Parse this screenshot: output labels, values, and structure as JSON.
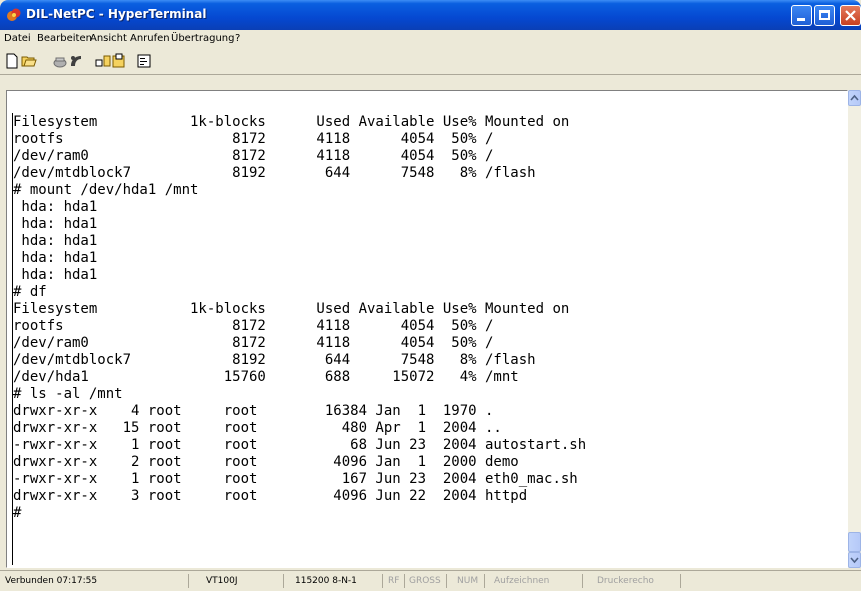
{
  "window": {
    "title": "DIL-NetPC - HyperTerminal"
  },
  "menu": [
    "Datei",
    "Bearbeiten",
    "Ansicht",
    "Anrufen",
    "Übertragung",
    "?"
  ],
  "toolbar": {
    "icons": [
      "new-icon",
      "open-icon",
      "call-icon",
      "hang-up-icon",
      "send-icon",
      "receive-icon",
      "properties-icon"
    ]
  },
  "terminal": {
    "lines": [
      "Filesystem           1k-blocks      Used Available Use% Mounted on",
      "rootfs                    8172      4118      4054  50% /",
      "/dev/ram0                 8172      4118      4054  50% /",
      "/dev/mtdblock7            8192       644      7548   8% /flash",
      "# mount /dev/hda1 /mnt",
      " hda: hda1",
      " hda: hda1",
      " hda: hda1",
      " hda: hda1",
      " hda: hda1",
      "# df",
      "Filesystem           1k-blocks      Used Available Use% Mounted on",
      "rootfs                    8172      4118      4054  50% /",
      "/dev/ram0                 8172      4118      4054  50% /",
      "/dev/mtdblock7            8192       644      7548   8% /flash",
      "/dev/hda1                15760       688     15072   4% /mnt",
      "# ls -al /mnt",
      "drwxr-xr-x    4 root     root        16384 Jan  1  1970 .",
      "drwxr-xr-x   15 root     root          480 Apr  1  2004 ..",
      "-rwxr-xr-x    1 root     root           68 Jun 23  2004 autostart.sh",
      "drwxr-xr-x    2 root     root         4096 Jan  1  2000 demo",
      "-rwxr-xr-x    1 root     root          167 Jun 23  2004 eth0_mac.sh",
      "drwxr-xr-x    3 root     root         4096 Jun 22  2004 httpd",
      "#"
    ]
  },
  "status": {
    "connected": "Verbunden 07:17:55",
    "emulation": "VT100J",
    "port": "115200 8-N-1",
    "rf": "RF",
    "gross": "GROSS",
    "num": "NUM",
    "capture": "Aufzeichnen",
    "echo": "Druckerecho"
  }
}
